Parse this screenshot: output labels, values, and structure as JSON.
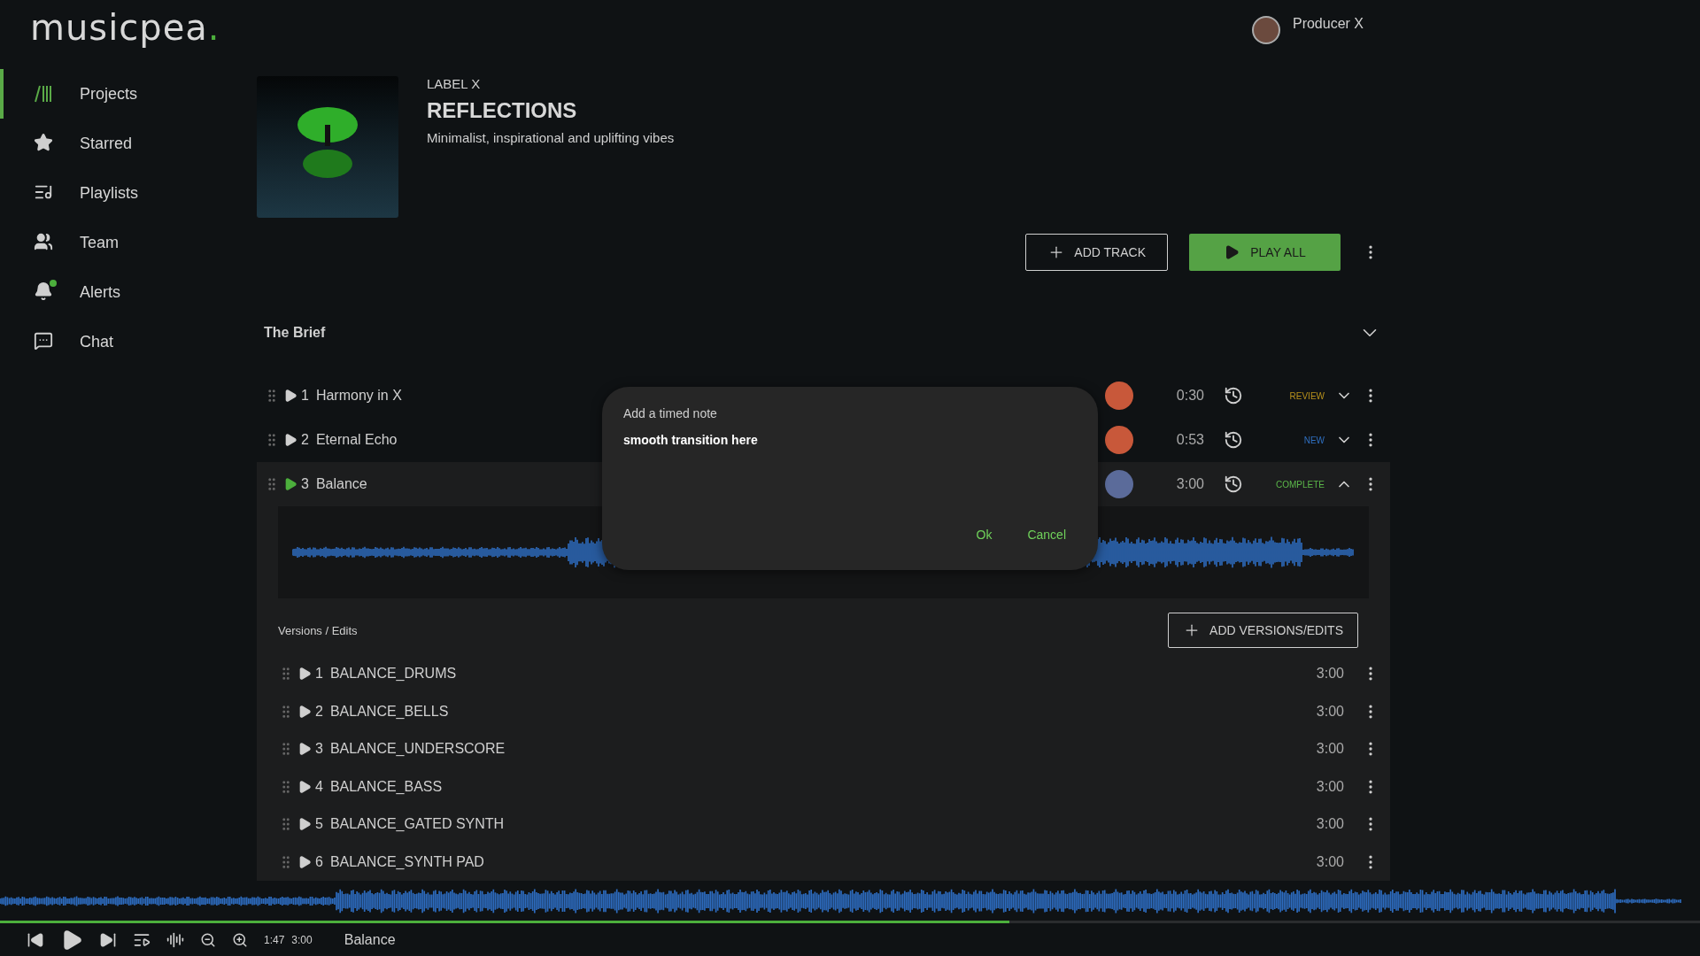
{
  "brand": {
    "name": "musicpea",
    "dot": "."
  },
  "sidebar": {
    "items": [
      {
        "label": "Projects",
        "kind": "projects",
        "selected": true,
        "unread": false
      },
      {
        "label": "Starred",
        "kind": "star",
        "selected": false,
        "unread": false
      },
      {
        "label": "Playlists",
        "kind": "playlist",
        "selected": false,
        "unread": false
      },
      {
        "label": "Team",
        "kind": "team",
        "selected": false,
        "unread": false
      },
      {
        "label": "Alerts",
        "kind": "bell",
        "selected": false,
        "unread": true
      },
      {
        "label": "Chat",
        "kind": "chat",
        "selected": false,
        "unread": false
      }
    ]
  },
  "user": {
    "name": "Producer X"
  },
  "project": {
    "label": "LABEL X",
    "title": "REFLECTIONS",
    "description": "Minimalist, inspirational and uplifting vibes"
  },
  "actions": {
    "add_track": "ADD TRACK",
    "play_all": "PLAY ALL"
  },
  "brief": {
    "title": "The Brief",
    "expanded": false
  },
  "tracks": [
    {
      "number": "1",
      "name": "Harmony in X",
      "time": "0:30",
      "status": "REVIEW",
      "color": "#b8911c",
      "expanded": false,
      "selected": false
    },
    {
      "number": "2",
      "name": "Eternal Echo",
      "time": "0:53",
      "status": "NEW",
      "color": "#2f6fc0",
      "expanded": false,
      "selected": false
    },
    {
      "number": "3",
      "name": "Balance",
      "time": "3:00",
      "status": "COMPLETE",
      "color": "#5cb84a",
      "expanded": true,
      "selected": true
    }
  ],
  "versions": {
    "title": "Versions / Edits",
    "add_button": "ADD VERSIONS/EDITS",
    "items": [
      {
        "number": "1",
        "name": "BALANCE_DRUMS",
        "time": "3:00"
      },
      {
        "number": "2",
        "name": "BALANCE_BELLS",
        "time": "3:00"
      },
      {
        "number": "3",
        "name": "BALANCE_UNDERSCORE",
        "time": "3:00"
      },
      {
        "number": "4",
        "name": "BALANCE_BASS",
        "time": "3:00"
      },
      {
        "number": "5",
        "name": "BALANCE_GATED SYNTH",
        "time": "3:00"
      },
      {
        "number": "6",
        "name": "BALANCE_SYNTH PAD",
        "time": "3:00"
      }
    ]
  },
  "dialog": {
    "title": "Add a timed note",
    "value": "smooth transition here",
    "ok": "Ok",
    "cancel": "Cancel"
  },
  "player": {
    "elapsed": "1:47",
    "duration": "3:00",
    "track": "Balance",
    "level": 0.594
  }
}
